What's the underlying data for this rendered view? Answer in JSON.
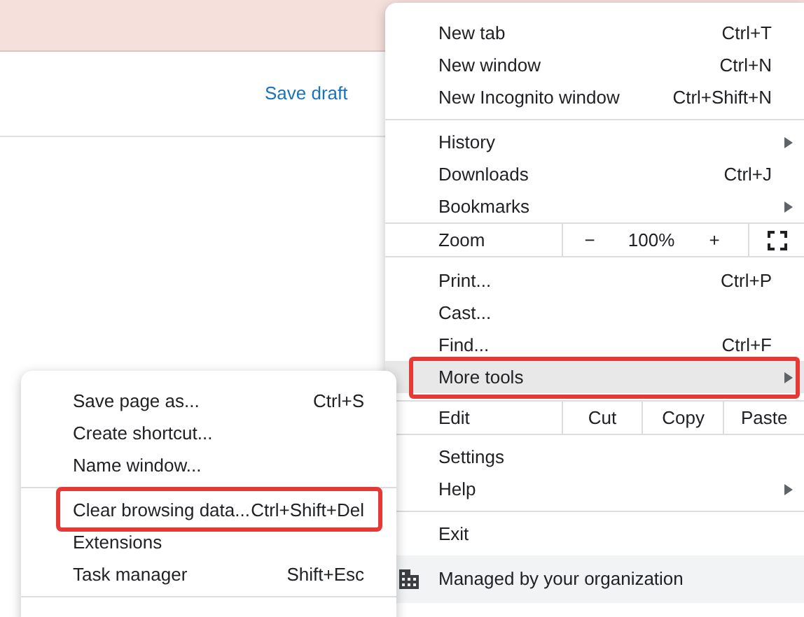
{
  "page": {
    "links": [
      {
        "label": "Save draft"
      }
    ]
  },
  "main_menu": {
    "rows": [
      {
        "kind": "item",
        "label": "New tab",
        "shortcut": "Ctrl+T",
        "has_submenu": false,
        "selected": false,
        "outlined": false
      },
      {
        "kind": "item",
        "label": "New window",
        "shortcut": "Ctrl+N",
        "has_submenu": false,
        "selected": false,
        "outlined": false
      },
      {
        "kind": "item",
        "label": "New Incognito window",
        "shortcut": "Ctrl+Shift+N",
        "has_submenu": false,
        "selected": false,
        "outlined": false
      },
      {
        "kind": "divider"
      },
      {
        "kind": "item",
        "label": "History",
        "has_submenu": true,
        "selected": false,
        "outlined": false
      },
      {
        "kind": "item",
        "label": "Downloads",
        "shortcut": "Ctrl+J",
        "has_submenu": false,
        "selected": false,
        "outlined": false
      },
      {
        "kind": "item",
        "label": "Bookmarks",
        "has_submenu": true,
        "selected": false,
        "outlined": false
      },
      {
        "kind": "zoom",
        "label": "Zoom",
        "minus": "−",
        "value": "100%",
        "plus": "+"
      },
      {
        "kind": "item",
        "label": "Print...",
        "shortcut": "Ctrl+P",
        "has_submenu": false,
        "selected": false,
        "outlined": false
      },
      {
        "kind": "item",
        "label": "Cast...",
        "has_submenu": false,
        "selected": false,
        "outlined": false
      },
      {
        "kind": "item",
        "label": "Find...",
        "shortcut": "Ctrl+F",
        "has_submenu": false,
        "selected": false,
        "outlined": false
      },
      {
        "kind": "item",
        "label": "More tools",
        "has_submenu": true,
        "selected": true,
        "outlined": true
      },
      {
        "kind": "edit",
        "label": "Edit",
        "buttons": [
          "Cut",
          "Copy",
          "Paste"
        ]
      },
      {
        "kind": "item",
        "label": "Settings",
        "has_submenu": false,
        "selected": false,
        "outlined": false
      },
      {
        "kind": "item",
        "label": "Help",
        "has_submenu": true,
        "selected": false,
        "outlined": false
      },
      {
        "kind": "divider"
      },
      {
        "kind": "item",
        "label": "Exit",
        "has_submenu": false,
        "selected": false,
        "outlined": false
      },
      {
        "kind": "managed",
        "label": "Managed by your organization"
      }
    ]
  },
  "sub_menu": {
    "rows": [
      {
        "kind": "item",
        "label": "Save page as...",
        "shortcut": "Ctrl+S",
        "selected": false,
        "outlined": false
      },
      {
        "kind": "item",
        "label": "Create shortcut...",
        "selected": false,
        "outlined": false
      },
      {
        "kind": "item",
        "label": "Name window...",
        "selected": false,
        "outlined": false
      },
      {
        "kind": "divider"
      },
      {
        "kind": "item",
        "label": "Clear browsing data...",
        "shortcut": "Ctrl+Shift+Del",
        "selected": false,
        "outlined": true
      },
      {
        "kind": "item",
        "label": "Extensions",
        "selected": false,
        "outlined": false
      },
      {
        "kind": "item",
        "label": "Task manager",
        "shortcut": "Shift+Esc",
        "selected": false,
        "outlined": false
      },
      {
        "kind": "divider"
      }
    ]
  }
}
